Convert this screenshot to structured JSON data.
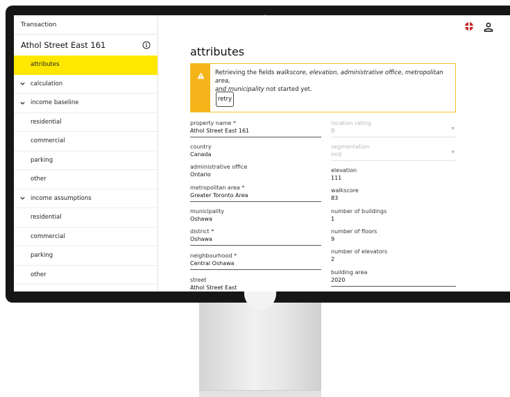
{
  "sidebar": {
    "header": "Transaction",
    "title": "Athol Street East 161",
    "items": [
      {
        "label": "attributes",
        "indent": true,
        "active": true,
        "chevron": false
      },
      {
        "label": "calculation",
        "indent": false,
        "active": false,
        "chevron": true
      },
      {
        "label": "income baseline",
        "indent": false,
        "active": false,
        "chevron": true
      },
      {
        "label": "residential",
        "indent": true,
        "active": false,
        "chevron": false
      },
      {
        "label": "commercial",
        "indent": true,
        "active": false,
        "chevron": false
      },
      {
        "label": "parking",
        "indent": true,
        "active": false,
        "chevron": false
      },
      {
        "label": "other",
        "indent": true,
        "active": false,
        "chevron": false
      },
      {
        "label": "income assumptions",
        "indent": false,
        "active": false,
        "chevron": true
      },
      {
        "label": "residential",
        "indent": true,
        "active": false,
        "chevron": false
      },
      {
        "label": "commercial",
        "indent": true,
        "active": false,
        "chevron": false
      },
      {
        "label": "parking",
        "indent": true,
        "active": false,
        "chevron": false
      },
      {
        "label": "other",
        "indent": true,
        "active": false,
        "chevron": false
      }
    ]
  },
  "main": {
    "title": "attributes",
    "alert": {
      "prefix": "Retrieving the fields ",
      "fields": "walkscore, elevation, administrative office, metropolitan area,",
      "and": "and ",
      "last_field": "municipality",
      "suffix": " not started yet.",
      "retry_label": "retry"
    },
    "left_fields": [
      {
        "label": "property name *",
        "value": "Athol Street East 161"
      },
      {
        "label": "country",
        "value": "Canada"
      },
      {
        "label": "administrative office",
        "value": "Ontario"
      },
      {
        "label": "metropolitan area *",
        "value": "Greater Toronto Area"
      },
      {
        "label": "municipality",
        "value": "Oshawa"
      },
      {
        "label": "district *",
        "value": "Oshawa"
      },
      {
        "label": "neighbourhood *",
        "value": "Central Oshawa"
      },
      {
        "label": "street",
        "value": "Athol Street East"
      }
    ],
    "right_fields": [
      {
        "label": "location rating",
        "value": "B"
      },
      {
        "label": "segmentation",
        "value": "mid"
      },
      {
        "label": "elevation",
        "value": "111"
      },
      {
        "label": "walkscore",
        "value": "83"
      },
      {
        "label": "number of buildings",
        "value": "1"
      },
      {
        "label": "number of floors",
        "value": "9"
      },
      {
        "label": "number of elevators",
        "value": "2"
      },
      {
        "label": "building area",
        "value": "2020"
      }
    ]
  },
  "colors": {
    "active_item": "#ffe800",
    "warning": "#f4b41a"
  }
}
